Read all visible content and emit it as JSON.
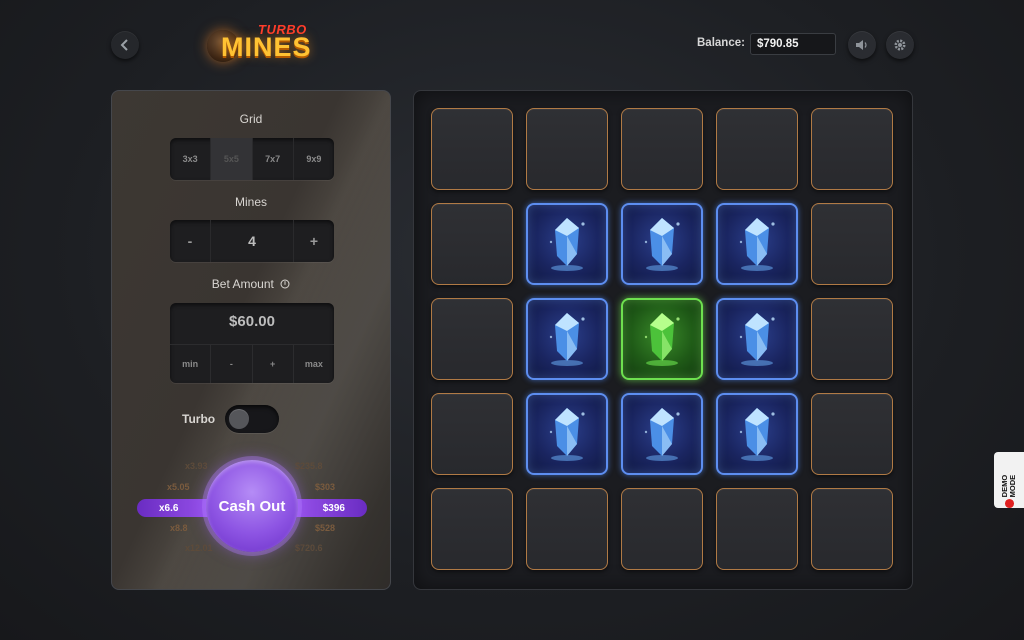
{
  "header": {
    "back_icon": "chevron-left-icon",
    "logo_top": "TURBO",
    "logo_main": "MINES",
    "balance_label": "Balance:",
    "balance_value": "$790.85",
    "sound_icon": "speaker-icon",
    "settings_icon": "gear-icon"
  },
  "panel": {
    "grid_label": "Grid",
    "grid_options": [
      "3x3",
      "5x5",
      "7x7",
      "9x9"
    ],
    "grid_selected": "5x5",
    "mines_label": "Mines",
    "mines_minus": "-",
    "mines_value": "4",
    "mines_plus": "+",
    "bet_label": "Bet Amount",
    "bet_info_icon": "info-icon",
    "bet_value": "$60.00",
    "bet_buttons": [
      "min",
      "-",
      "+",
      "max"
    ],
    "turbo_label": "Turbo",
    "turbo_on": false,
    "cashout_label": "Cash Out",
    "multiplier_current": "x6.6",
    "payout_current": "$396",
    "multipliers_above": [
      "x3.93",
      "x5.05"
    ],
    "payouts_above": [
      "$235.8",
      "$303"
    ],
    "multipliers_below": [
      "x8.8",
      "x12.01"
    ],
    "payouts_below": [
      "$528",
      "$720.6"
    ]
  },
  "board": {
    "size": 5,
    "tiles": [
      "hidden",
      "hidden",
      "hidden",
      "hidden",
      "hidden",
      "hidden",
      "gem",
      "gem",
      "gem",
      "hidden",
      "hidden",
      "gem",
      "gem-win",
      "gem",
      "hidden",
      "hidden",
      "gem",
      "gem",
      "gem",
      "hidden",
      "hidden",
      "hidden",
      "hidden",
      "hidden",
      "hidden"
    ]
  },
  "demo_badge": "DEMO MODE",
  "colors": {
    "accent_purple": "#8d54e3",
    "tile_border": "#b07a45",
    "gem_blue": "#5d8ef0",
    "gem_green": "#6ee04f"
  }
}
